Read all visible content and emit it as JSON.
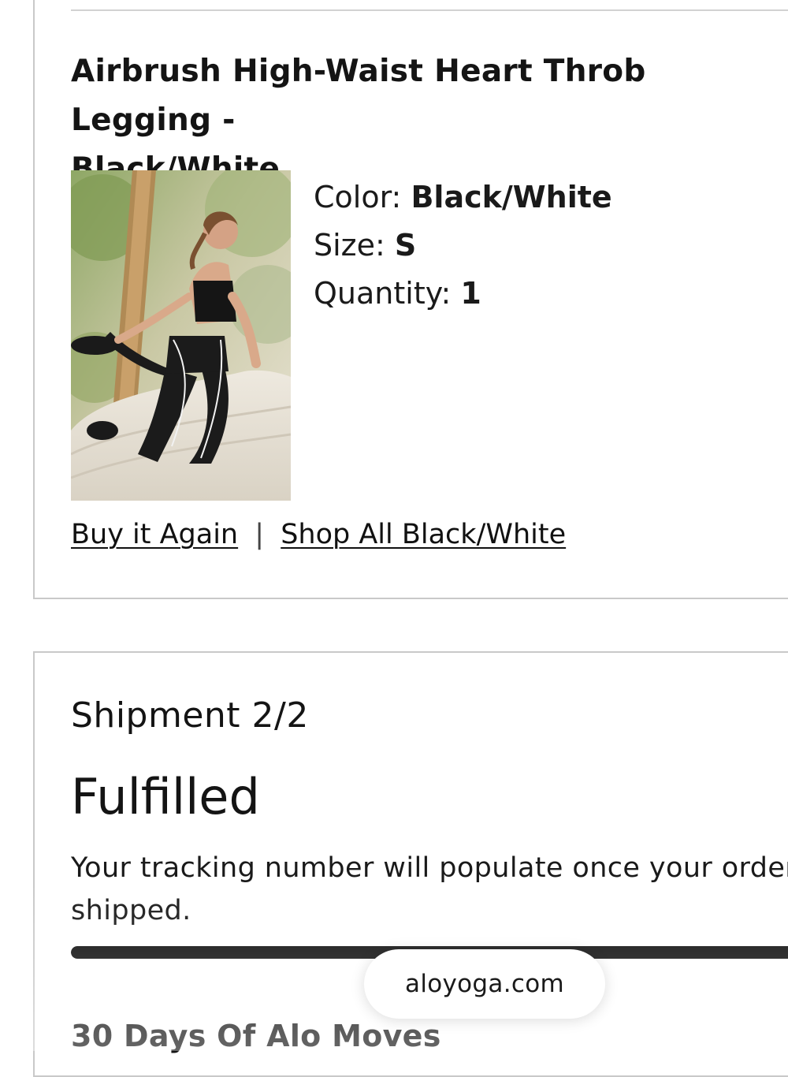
{
  "item": {
    "title_line1": "Airbrush High-Waist Heart Throb Legging -",
    "title_line2": "Black/White",
    "color_label": "Color:",
    "color_value": "Black/White",
    "size_label": "Size:",
    "size_value": "S",
    "quantity_label": "Quantity:",
    "quantity_value": "1",
    "buy_again": "Buy it Again",
    "separator": "|",
    "shop_all": "Shop All Black/White",
    "image_icon": "product-photo-woman-in-black-leggings"
  },
  "shipment": {
    "label": "Shipment 2/2",
    "status": "Fulfilled",
    "message_line1": "Your tracking number will populate once your order",
    "message_line2": "shipped.",
    "progress": 1.0
  },
  "promo": {
    "title": "30 Days Of Alo Moves"
  },
  "browser": {
    "url": "aloyoga.com"
  },
  "colors": {
    "border": "#c9c9c9",
    "progress": "#0d0d0d",
    "text": "#111111"
  }
}
